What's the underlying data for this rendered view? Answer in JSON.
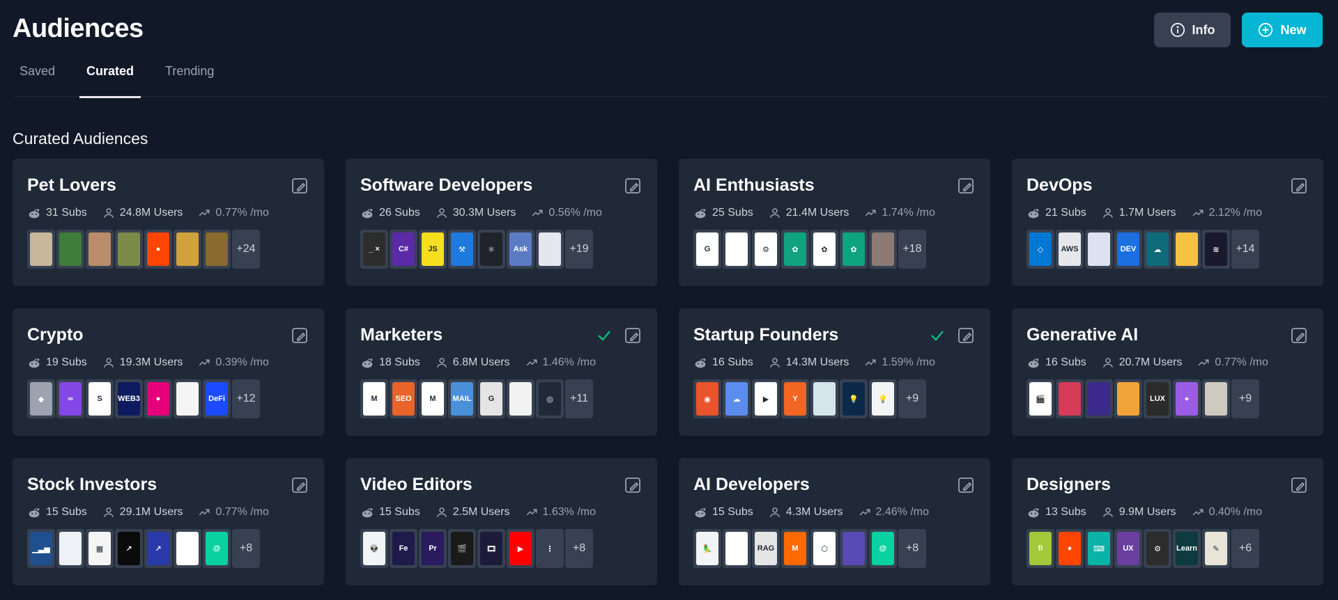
{
  "page": {
    "title": "Audiences"
  },
  "actions": {
    "info_label": "Info",
    "new_label": "New"
  },
  "tabs": [
    {
      "label": "Saved",
      "active": false
    },
    {
      "label": "Curated",
      "active": true
    },
    {
      "label": "Trending",
      "active": false
    }
  ],
  "section_title": "Curated Audiences",
  "colors": {
    "accent": "#06b6d4",
    "check": "#10b981",
    "card_bg": "#1f2937",
    "page_bg": "#111827"
  },
  "cards": [
    {
      "title": "Pet Lovers",
      "subs": "31 Subs",
      "users": "24.8M Users",
      "growth": "0.77% /mo",
      "more": "+24",
      "checked": false,
      "icons": [
        {
          "bg": "#c9b79c",
          "text": ""
        },
        {
          "bg": "#3f7d3a",
          "text": ""
        },
        {
          "bg": "#b98d6b",
          "text": ""
        },
        {
          "bg": "#7a8b4a",
          "text": ""
        },
        {
          "bg": "#ff4500",
          "text": "●"
        },
        {
          "bg": "#d1a23b",
          "text": ""
        },
        {
          "bg": "#8a6a2e",
          "text": ""
        }
      ]
    },
    {
      "title": "Software Developers",
      "subs": "26 Subs",
      "users": "30.3M Users",
      "growth": "0.56% /mo",
      "more": "+19",
      "checked": false,
      "icons": [
        {
          "bg": "#2d2d2d",
          "text": "_ ×"
        },
        {
          "bg": "#5b2aa6",
          "text": "C#"
        },
        {
          "bg": "#f7df1e",
          "text": "JS"
        },
        {
          "bg": "#1f7ae0",
          "text": "⚒"
        },
        {
          "bg": "#20232a",
          "text": "⚛"
        },
        {
          "bg": "#5b7cc4",
          "text": "Ask"
        },
        {
          "bg": "#e6e6ee",
          "text": ""
        }
      ]
    },
    {
      "title": "AI Enthusiasts",
      "subs": "25 Subs",
      "users": "21.4M Users",
      "growth": "1.74% /mo",
      "more": "+18",
      "checked": false,
      "icons": [
        {
          "bg": "#ffffff",
          "text": "G"
        },
        {
          "bg": "#ffffff",
          "text": ""
        },
        {
          "bg": "#ffffff",
          "text": "⚙"
        },
        {
          "bg": "#10a37f",
          "text": "✿"
        },
        {
          "bg": "#ffffff",
          "text": "✿"
        },
        {
          "bg": "#10a37f",
          "text": "✿"
        },
        {
          "bg": "#8c7b74",
          "text": ""
        }
      ]
    },
    {
      "title": "DevOps",
      "subs": "21 Subs",
      "users": "1.7M Users",
      "growth": "2.12% /mo",
      "more": "+14",
      "checked": false,
      "icons": [
        {
          "bg": "#0078d4",
          "text": "◇"
        },
        {
          "bg": "#e5e7eb",
          "text": "AWS"
        },
        {
          "bg": "#dde2f0",
          "text": ""
        },
        {
          "bg": "#1d6fe0",
          "text": "DEV"
        },
        {
          "bg": "#0f6b7a",
          "text": "☁"
        },
        {
          "bg": "#f5c242",
          "text": ""
        },
        {
          "bg": "#1a1a2e",
          "text": "≋"
        }
      ]
    },
    {
      "title": "Crypto",
      "subs": "19 Subs",
      "users": "19.3M Users",
      "growth": "0.39% /mo",
      "more": "+12",
      "checked": false,
      "icons": [
        {
          "bg": "#9ca3af",
          "text": "◆"
        },
        {
          "bg": "#8247e5",
          "text": "∞"
        },
        {
          "bg": "#ffffff",
          "text": "S"
        },
        {
          "bg": "#0d1b5e",
          "text": "WEB3"
        },
        {
          "bg": "#e6007a",
          "text": "●"
        },
        {
          "bg": "#f5f5f5",
          "text": ""
        },
        {
          "bg": "#1c4bff",
          "text": "DeFi"
        }
      ]
    },
    {
      "title": "Marketers",
      "subs": "18 Subs",
      "users": "6.8M Users",
      "growth": "1.46% /mo",
      "more": "+11",
      "checked": true,
      "icons": [
        {
          "bg": "#ffffff",
          "text": "M"
        },
        {
          "bg": "#e8642b",
          "text": "SEO"
        },
        {
          "bg": "#ffffff",
          "text": "M"
        },
        {
          "bg": "#4a90d9",
          "text": "MAIL"
        },
        {
          "bg": "#e5e5e5",
          "text": "G"
        },
        {
          "bg": "#f2f2f2",
          "text": ""
        },
        {
          "bg": "#1f2937",
          "text": "◎"
        }
      ]
    },
    {
      "title": "Startup Founders",
      "subs": "16 Subs",
      "users": "14.3M Users",
      "growth": "1.59% /mo",
      "more": "+9",
      "checked": true,
      "icons": [
        {
          "bg": "#e8542b",
          "text": "◉"
        },
        {
          "bg": "#5b8dee",
          "text": "☁"
        },
        {
          "bg": "#ffffff",
          "text": "▶"
        },
        {
          "bg": "#f26522",
          "text": "Y"
        },
        {
          "bg": "#d6e4ec",
          "text": ""
        },
        {
          "bg": "#0b2a4a",
          "text": "💡"
        },
        {
          "bg": "#f3f4f6",
          "text": "💡"
        }
      ]
    },
    {
      "title": "Generative AI",
      "subs": "16 Subs",
      "users": "20.7M Users",
      "growth": "0.77% /mo",
      "more": "+9",
      "checked": false,
      "icons": [
        {
          "bg": "#ffffff",
          "text": "🎬"
        },
        {
          "bg": "#d63b5a",
          "text": ""
        },
        {
          "bg": "#3b2a8a",
          "text": ""
        },
        {
          "bg": "#f2a33a",
          "text": ""
        },
        {
          "bg": "#2b2b2b",
          "text": "LUX"
        },
        {
          "bg": "#9b5de5",
          "text": "✦"
        },
        {
          "bg": "#cfcac0",
          "text": ""
        }
      ]
    },
    {
      "title": "Stock Investors",
      "subs": "15 Subs",
      "users": "29.1M Users",
      "growth": "0.77% /mo",
      "more": "+8",
      "checked": false,
      "icons": [
        {
          "bg": "#1f4f8f",
          "text": "▁▃▅"
        },
        {
          "bg": "#eef2f7",
          "text": ""
        },
        {
          "bg": "#f5f5f5",
          "text": "▦"
        },
        {
          "bg": "#0b0b0b",
          "text": "↗"
        },
        {
          "bg": "#2a3aa8",
          "text": "↗"
        },
        {
          "bg": "#ffffff",
          "text": ""
        },
        {
          "bg": "#0ad1a0",
          "text": "@"
        }
      ]
    },
    {
      "title": "Video Editors",
      "subs": "15 Subs",
      "users": "2.5M Users",
      "growth": "1.63% /mo",
      "more": "+8",
      "checked": false,
      "icons": [
        {
          "bg": "#f3f4f6",
          "text": "👽"
        },
        {
          "bg": "#1e1b4b",
          "text": "Fe"
        },
        {
          "bg": "#2a1a5e",
          "text": "Pr"
        },
        {
          "bg": "#1a1a1a",
          "text": "🎬"
        },
        {
          "bg": "#1c1c3a",
          "text": "🎞"
        },
        {
          "bg": "#ff0000",
          "text": "▶"
        },
        {
          "bg": "#374151",
          "text": "⋮"
        }
      ]
    },
    {
      "title": "AI Developers",
      "subs": "15 Subs",
      "users": "4.3M Users",
      "growth": "2.46% /mo",
      "more": "+8",
      "checked": false,
      "icons": [
        {
          "bg": "#f3f4f6",
          "text": "🦜"
        },
        {
          "bg": "#ffffff",
          "text": ""
        },
        {
          "bg": "#e5e5e5",
          "text": "RAG"
        },
        {
          "bg": "#ff6a00",
          "text": "M"
        },
        {
          "bg": "#ffffff",
          "text": "⬡"
        },
        {
          "bg": "#5a4ab5",
          "text": ""
        },
        {
          "bg": "#0ad1a0",
          "text": "@"
        }
      ]
    },
    {
      "title": "Designers",
      "subs": "13 Subs",
      "users": "9.9M Users",
      "growth": "0.40% /mo",
      "more": "+6",
      "checked": false,
      "icons": [
        {
          "bg": "#a3c93a",
          "text": "fi"
        },
        {
          "bg": "#ff4500",
          "text": "●"
        },
        {
          "bg": "#0ab3a6",
          "text": "⌨"
        },
        {
          "bg": "#6b3fa0",
          "text": "UX"
        },
        {
          "bg": "#2d2d2d",
          "text": "⚙"
        },
        {
          "bg": "#0d3b3f",
          "text": "Learn"
        },
        {
          "bg": "#e8e4d8",
          "text": "✎"
        }
      ]
    }
  ]
}
